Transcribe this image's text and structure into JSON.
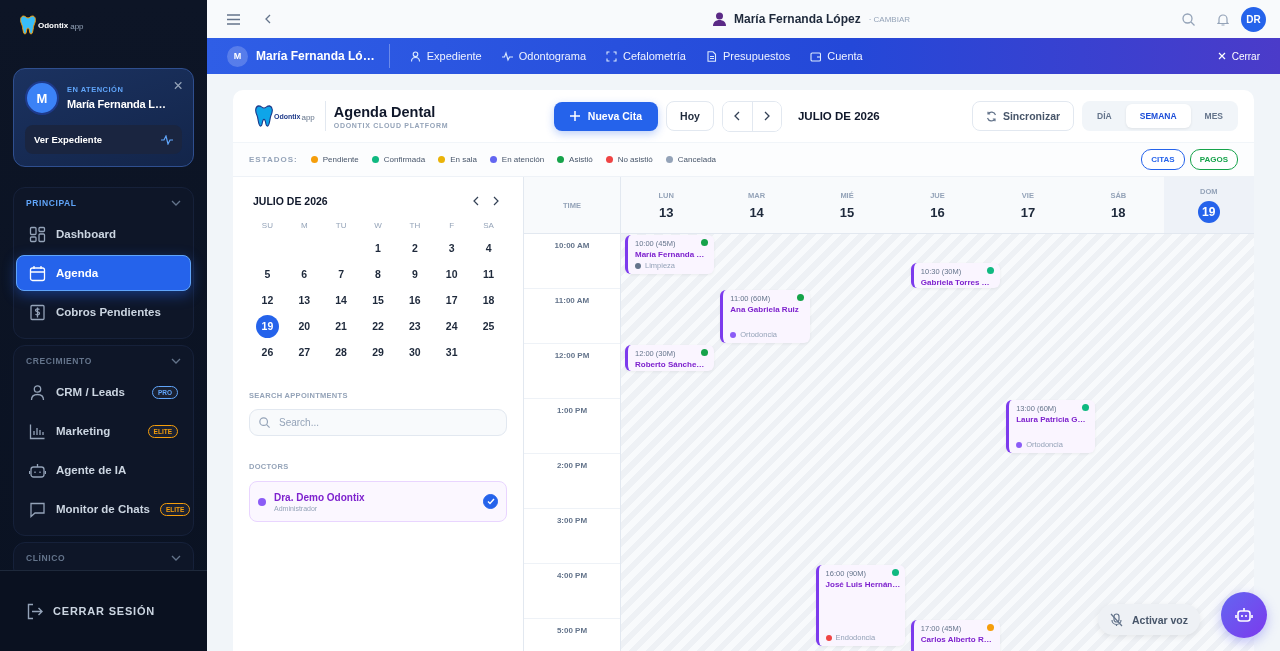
{
  "sidebar": {
    "logo": {
      "name": "Odontix",
      "suffix": "app"
    },
    "patient_card": {
      "avatar": "M",
      "status": "EN ATENCIÓN",
      "name": "María Fernanda L…",
      "button": "Ver Expediente"
    },
    "sections": [
      {
        "title": "PRINCIPAL",
        "expanded": true,
        "items": [
          {
            "label": "Dashboard",
            "selected": false
          },
          {
            "label": "Agenda",
            "selected": true
          },
          {
            "label": "Cobros Pendientes",
            "selected": false
          }
        ]
      },
      {
        "title": "CRECIMIENTO",
        "expanded": true,
        "items": [
          {
            "label": "CRM / Leads",
            "selected": false,
            "badge": {
              "label": "PRO",
              "color": "#60a5fa"
            }
          },
          {
            "label": "Marketing",
            "selected": false,
            "badge": {
              "label": "ELITE",
              "color": "#f59e0b"
            }
          },
          {
            "label": "Agente de IA",
            "selected": false
          },
          {
            "label": "Monitor de Chats",
            "selected": false,
            "badge": {
              "label": "ELITE",
              "color": "#f59e0b"
            }
          }
        ]
      },
      {
        "title": "CLÍNICO",
        "expanded": true
      }
    ],
    "logout": "CERRAR SESIÓN"
  },
  "topbar": {
    "patient": "María Fernanda López",
    "change": "· CAMBIAR",
    "avatar": "DR"
  },
  "patient_bar": {
    "avatar": "M",
    "name": "María Fernanda Ló…",
    "tabs": [
      "Expediente",
      "Odontograma",
      "Cefalometría",
      "Presupuestos",
      "Cuenta"
    ],
    "close": "Cerrar"
  },
  "agenda": {
    "logo": {
      "name": "Odontix",
      "suffix": "app"
    },
    "title": "Agenda Dental",
    "subtitle": "ODONTIX CLOUD PLATFORM",
    "new_button": "Nueva Cita",
    "today_button": "Hoy",
    "period": "JULIO DE 2026",
    "sync_button": "Sincronizar",
    "views": [
      {
        "label": "DÍA",
        "selected": false
      },
      {
        "label": "SEMANA",
        "selected": true
      },
      {
        "label": "MES",
        "selected": false
      }
    ]
  },
  "legend": {
    "label": "ESTADOS:",
    "items": [
      {
        "label": "Pendiente",
        "color": "#f59e0b"
      },
      {
        "label": "Confirmada",
        "color": "#10b981"
      },
      {
        "label": "En sala",
        "color": "#eab308"
      },
      {
        "label": "En atención",
        "color": "#6366f1"
      },
      {
        "label": "Asistió",
        "color": "#16a34a"
      },
      {
        "label": "No asistió",
        "color": "#ef4444"
      },
      {
        "label": "Cancelada",
        "color": "#94a3b8"
      }
    ],
    "toggles": [
      {
        "label": "CITAS",
        "color": "#2563eb"
      },
      {
        "label": "PAGOS",
        "color": "#16a34a"
      }
    ]
  },
  "mini_calendar": {
    "title": "JULIO DE 2026",
    "weekdays": [
      "SU",
      "M",
      "TU",
      "W",
      "TH",
      "F",
      "SA"
    ],
    "weeks": [
      [
        {
          "day": "1",
          "selected": false
        },
        {
          "day": "2",
          "selected": false
        },
        {
          "day": "3",
          "selected": false
        },
        {
          "day": "4",
          "selected": false
        }
      ],
      [
        {
          "day": "5",
          "selected": false
        },
        {
          "day": "6",
          "selected": false
        },
        {
          "day": "7",
          "selected": false
        },
        {
          "day": "8",
          "selected": false
        },
        {
          "day": "9",
          "selected": false
        },
        {
          "day": "10",
          "selected": false
        },
        {
          "day": "11",
          "selected": false
        }
      ],
      [
        {
          "day": "12",
          "selected": false
        },
        {
          "day": "13",
          "selected": false
        },
        {
          "day": "14",
          "selected": false
        },
        {
          "day": "15",
          "selected": false
        },
        {
          "day": "16",
          "selected": false
        },
        {
          "day": "17",
          "selected": false
        },
        {
          "day": "18",
          "selected": false
        }
      ],
      [
        {
          "day": "19",
          "selected": true
        },
        {
          "day": "20",
          "selected": false
        },
        {
          "day": "21",
          "selected": false
        },
        {
          "day": "22",
          "selected": false
        },
        {
          "day": "23",
          "selected": false
        },
        {
          "day": "24",
          "selected": false
        },
        {
          "day": "25",
          "selected": false
        }
      ],
      [
        {
          "day": "26",
          "selected": false
        },
        {
          "day": "27",
          "selected": false
        },
        {
          "day": "28",
          "selected": false
        },
        {
          "day": "29",
          "selected": false
        },
        {
          "day": "30",
          "selected": false
        },
        {
          "day": "31",
          "selected": false
        }
      ]
    ]
  },
  "search": {
    "label": "SEARCH APPOINTMENTS",
    "placeholder": "Search..."
  },
  "doctors": {
    "label": "DOCTORS",
    "items": [
      {
        "name": "Dra. Demo Odontix",
        "role": "Administrador",
        "color": "#8b5cf6",
        "checked": true
      }
    ]
  },
  "week": {
    "time_label": "TIME",
    "hours": [
      "10:00 AM",
      "11:00 AM",
      "12:00 PM",
      "1:00 PM",
      "2:00 PM",
      "3:00 PM",
      "4:00 PM",
      "5:00 PM"
    ],
    "days": [
      {
        "name": "LUN",
        "date": "13",
        "selected": false,
        "events": [
          {
            "time": "10:00 (45M)",
            "patient": "María Fernanda …",
            "color": "#16a34a",
            "category": {
              "label": "Limpieza",
              "color": "#64748b"
            }
          },
          {
            "time": "12:00 (30M)",
            "patient": "Roberto Sánche…",
            "color": "#16a34a"
          }
        ]
      },
      {
        "name": "MAR",
        "date": "14",
        "selected": false,
        "events": [
          {
            "time": "11:00 (60M)",
            "patient": "Ana Gabriela Ruiz",
            "color": "#16a34a",
            "category": {
              "label": "Ortodoncia",
              "color": "#8b5cf6"
            }
          }
        ]
      },
      {
        "name": "MIÉ",
        "date": "15",
        "selected": false,
        "events": [
          {
            "time": "16:00 (90M)",
            "patient": "José Luis Hernán…",
            "color": "#10b981",
            "category": {
              "label": "Endodoncia",
              "color": "#ef4444"
            }
          }
        ]
      },
      {
        "name": "JUE",
        "date": "16",
        "selected": false,
        "events": [
          {
            "time": "10:30 (30M)",
            "patient": "Gabriela Torres …",
            "color": "#10b981"
          },
          {
            "time": "17:00 (45M)",
            "patient": "Carlos Alberto R…",
            "color": "#f59e0b"
          }
        ]
      },
      {
        "name": "VIE",
        "date": "17",
        "selected": false,
        "events": [
          {
            "time": "13:00 (60M)",
            "patient": "Laura Patricia G…",
            "color": "#10b981",
            "category": {
              "label": "Ortodoncia",
              "color": "#8b5cf6"
            }
          }
        ]
      },
      {
        "name": "SÁB",
        "date": "18",
        "selected": false
      },
      {
        "name": "DOM",
        "date": "19",
        "selected": true
      }
    ]
  },
  "voice_button": "Activar voz"
}
